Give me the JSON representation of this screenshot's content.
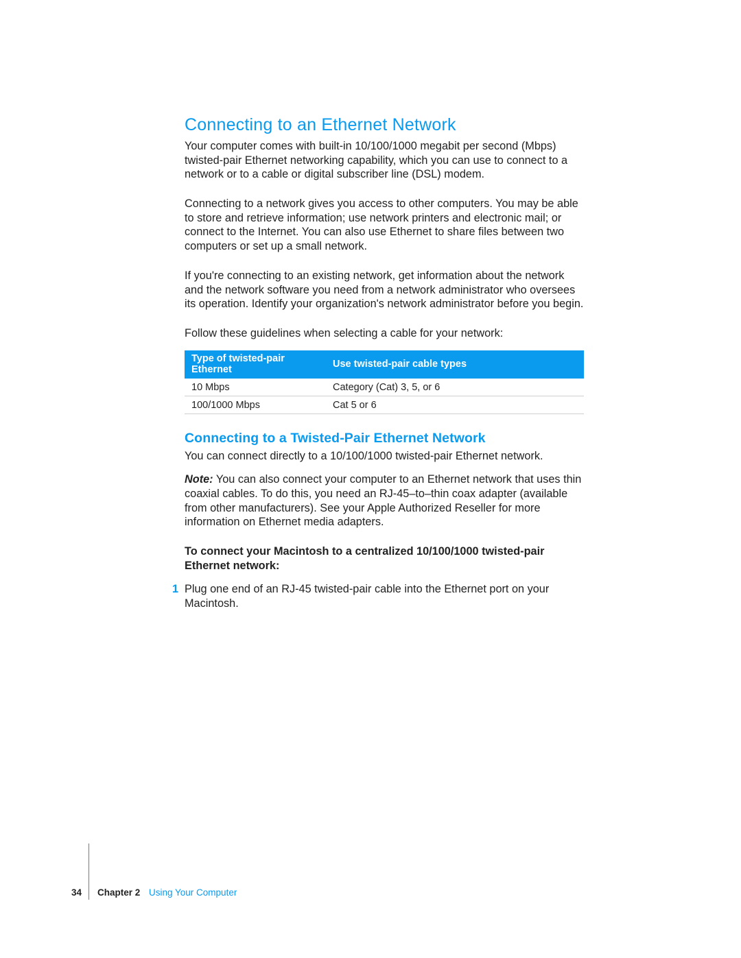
{
  "heading": "Connecting to an Ethernet Network",
  "para1": "Your computer comes with built-in 10/100/1000 megabit per second (Mbps) twisted-pair Ethernet networking capability, which you can use to connect to a network or to a cable or digital subscriber line (DSL) modem.",
  "para2": "Connecting to a network gives you access to other computers. You may be able to store and retrieve information; use network printers and electronic mail; or connect to the Internet. You can also use Ethernet to share files between two computers or set up a small network.",
  "para3": "If you're connecting to an existing network, get information about the network and the network software you need from a network administrator who oversees its operation. Identify your organization's network administrator before you begin.",
  "para4": "Follow these guidelines when selecting a cable for your network:",
  "table": {
    "headers": [
      "Type of twisted-pair Ethernet",
      "Use twisted-pair cable types"
    ],
    "rows": [
      [
        "10 Mbps",
        "Category (Cat) 3, 5, or 6"
      ],
      [
        "100/1000 Mbps",
        "Cat 5 or 6"
      ]
    ]
  },
  "subheading": "Connecting to a Twisted-Pair Ethernet Network",
  "para5": "You can connect directly to a 10/100/1000 twisted-pair Ethernet network.",
  "note_label": "Note:",
  "note_body": "  You can also connect your computer to an Ethernet network that uses thin coaxial cables. To do this, you need an RJ-45–to–thin coax adapter (available from other manufacturers). See your Apple Authorized Reseller for more information on Ethernet media adapters.",
  "bold_lead": "To connect your Macintosh to a centralized 10/100/1000 twisted-pair Ethernet network:",
  "step1_num": "1",
  "step1_text": "Plug one end of an RJ-45 twisted-pair cable into the Ethernet port on your Macintosh.",
  "footer": {
    "page": "34",
    "chapter_label": "Chapter 2",
    "chapter_name": "Using Your Computer"
  }
}
